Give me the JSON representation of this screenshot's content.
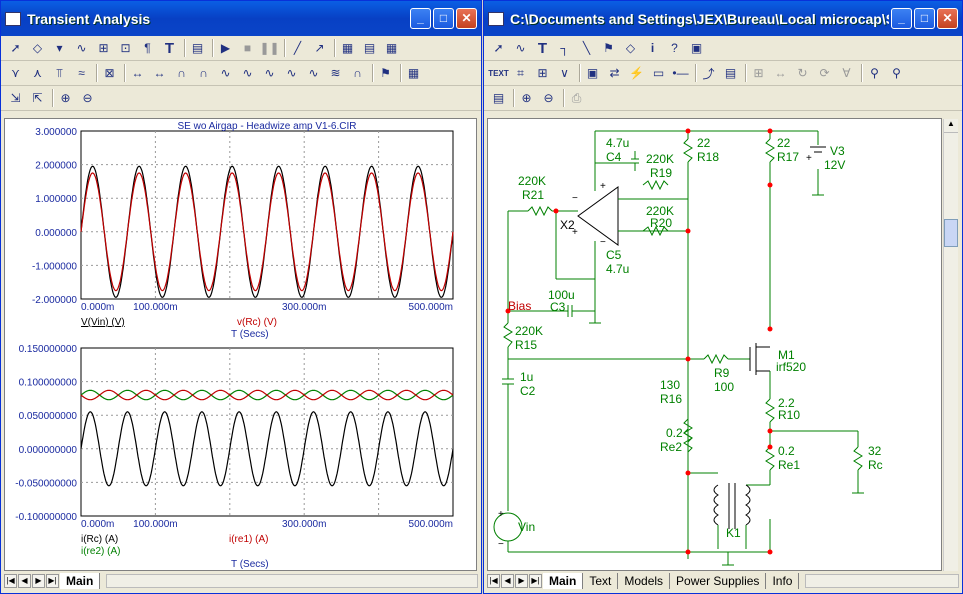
{
  "left_window": {
    "title": "Transient Analysis",
    "toolbar_row1": [
      "select-arrow-icon",
      "node-icon",
      "scale-icon",
      "cursor-mode-icon",
      "zoom-box-icon",
      "graph-add-icon",
      "label-icon",
      "text-tool-icon",
      "properties-icon",
      "run-icon",
      "stop-icon",
      "pause-icon",
      "line-tool-icon",
      "arrow-tool-icon",
      "grid-icon",
      "grid-bold-icon",
      "grid-minor-icon"
    ],
    "toolbar_row2": [
      "peak-icon",
      "valley-icon",
      "high-icon",
      "low-icon",
      "inflection-icon",
      "global-high-icon",
      "global-low-icon",
      "slope-icon",
      "point-tag-icon",
      "horizontal-tag-icon",
      "vertical-tag-icon",
      "performance-tag-icon"
    ],
    "toolbar_row3": [
      "x-scale-icon",
      "y-scale-icon",
      "zoom-in-icon",
      "zoom-out-icon"
    ],
    "top_plot": {
      "title": "SE wo Airgap - Headwize amp V1-6.CIR",
      "yticks": [
        "3.000000",
        "2.000000",
        "1.000000",
        "0.000000",
        "-1.000000",
        "-2.000000"
      ],
      "xticks": [
        "0.000m",
        "100.000m",
        "300.000m",
        "500.000m"
      ],
      "xlabel": "T (Secs)",
      "legend": [
        "V(Vin) (V)",
        "v(Rc) (V)"
      ]
    },
    "bottom_plot": {
      "yticks": [
        "0.150000000",
        "0.100000000",
        "0.050000000",
        "0.000000000",
        "-0.050000000",
        "-0.100000000"
      ],
      "xticks": [
        "0.000m",
        "100.000m",
        "300.000m",
        "500.000m"
      ],
      "xlabel": "T (Secs)",
      "legend": [
        "i(Rc) (A)",
        "i(re2) (A)",
        "i(re1) (A)"
      ]
    },
    "tabs": [
      "Main"
    ]
  },
  "right_window": {
    "title": "C:\\Documents and Settings\\JEX\\Bureau\\Local microcap\\SE ...",
    "toolbar_row1": [
      "select-arrow-icon",
      "wire-icon",
      "text-tool-icon",
      "ortho-wire-icon",
      "diagonal-wire-icon",
      "flag-icon",
      "component-icon",
      "info-icon",
      "help-icon",
      "dots-icon"
    ],
    "toolbar_row2": [
      "text-mode-icon",
      "node-numbers-icon",
      "attribute-icon",
      "pin-markers-icon",
      "grid-text-icon",
      "node-voltage-icon",
      "current-icon",
      "power-icon",
      "pin-connections-icon",
      "cross-probe-icon",
      "properties-icon",
      "step-icon",
      "rotate-icon",
      "flip-x-icon",
      "flip-y-icon",
      "find-icon",
      "find-next-icon"
    ],
    "toolbar_row3": [
      "info-page-icon",
      "zoom-in-icon",
      "zoom-out-icon",
      "print-icon"
    ],
    "schematic_labels": {
      "C4": "C4",
      "C4v": "4.7u",
      "R18": "R18",
      "R18v": "22",
      "R17": "R17",
      "R17v": "22",
      "V3": "V3",
      "V3v": "12V",
      "R19": "R19",
      "R19v": "220K",
      "R21": "R21",
      "R21v": "220K",
      "X2": "X2",
      "R20": "R20",
      "R20v": "220K",
      "C5": "C5",
      "C5v": "4.7u",
      "C3": "C3",
      "C3v": "100u",
      "Bias": "Bias",
      "R15": "R15",
      "R15v": "220K",
      "M1": "M1",
      "M1v": "irf520",
      "R9": "R9",
      "R9v": "100",
      "C2": "C2",
      "C2v": "1u",
      "R16": "R16",
      "R16v": "130",
      "R10": "R10",
      "R10v": "2.2",
      "Re2": "Re2",
      "Re2v": "0.2",
      "Re1": "Re1",
      "Re1v": "0.2",
      "Rc": "Rc",
      "Rcv": "32",
      "Vin": "Vin",
      "K1": "K1"
    },
    "tabs": [
      "Main",
      "Text",
      "Models",
      "Power Supplies",
      "Info"
    ]
  },
  "chart_data": [
    {
      "type": "line",
      "title": "SE wo Airgap - Headwize amp V1-6.CIR",
      "xlabel": "T (Secs)",
      "xlim": [
        0,
        0.5
      ],
      "ylim": [
        -2,
        3
      ],
      "series": [
        {
          "name": "V(Vin) (V)",
          "color": "#000000",
          "amplitude": 1.95,
          "periods": 8
        },
        {
          "name": "v(Rc) (V)",
          "color": "#c00000",
          "amplitude": 1.75,
          "periods": 8
        }
      ]
    },
    {
      "type": "line",
      "xlabel": "T (Secs)",
      "xlim": [
        0,
        0.5
      ],
      "ylim": [
        -0.1,
        0.15
      ],
      "series": [
        {
          "name": "i(Rc) (A)",
          "color": "#000000",
          "offset": 0,
          "amplitude": 0.055,
          "periods": 10
        },
        {
          "name": "i(re2) (A)",
          "color": "#008000",
          "offset": 0.08,
          "amplitude": 0.007,
          "periods": 10
        },
        {
          "name": "i(re1) (A)",
          "color": "#c00000",
          "offset": 0.08,
          "amplitude": 0.007,
          "periods": 10,
          "phase": 3.14159
        }
      ]
    }
  ]
}
